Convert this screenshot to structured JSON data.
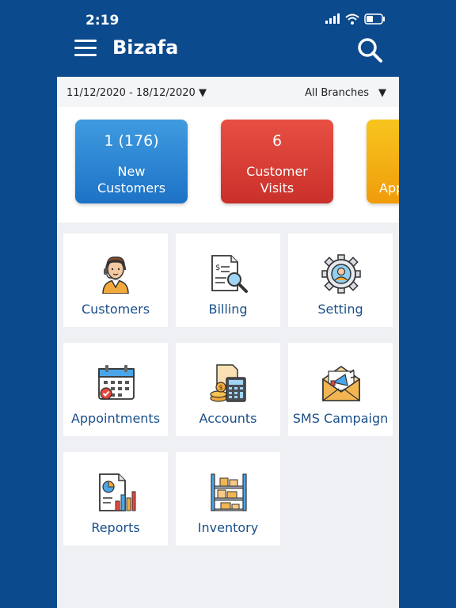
{
  "status_bar": {
    "time": "2:19"
  },
  "header": {
    "title": "Bizafa"
  },
  "filters": {
    "date_range": "11/12/2020 - 18/12/2020",
    "branch": "All Branches"
  },
  "stats": [
    {
      "value": "1 (176)",
      "label_line1": "New",
      "label_line2": "Customers",
      "color": "#2a86d6"
    },
    {
      "value": "6",
      "label_line1": "Customer",
      "label_line2": "Visits",
      "color": "#dc4037"
    },
    {
      "value": "",
      "label_line1": "App",
      "label_line2": "",
      "color": "#f5b515"
    }
  ],
  "tiles": [
    {
      "label": "Customers",
      "icon": "customer-service-icon"
    },
    {
      "label": "Billing",
      "icon": "invoice-search-icon"
    },
    {
      "label": "Setting",
      "icon": "gear-user-icon"
    },
    {
      "label": "Appointments",
      "icon": "calendar-icon"
    },
    {
      "label": "Accounts",
      "icon": "calculator-money-icon"
    },
    {
      "label": "SMS Campaign",
      "icon": "envelope-megaphone-icon"
    },
    {
      "label": "Reports",
      "icon": "report-chart-icon"
    },
    {
      "label": "Inventory",
      "icon": "warehouse-shelves-icon"
    }
  ],
  "colors": {
    "brand": "#0b4a8c",
    "tile_text": "#1a4f8a"
  }
}
